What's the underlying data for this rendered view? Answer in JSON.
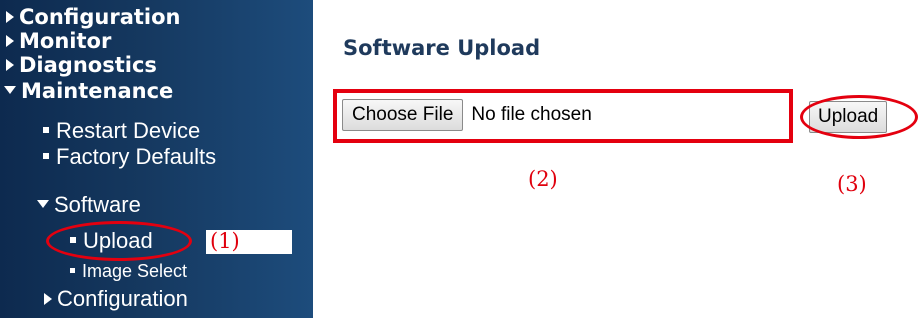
{
  "sidebar": {
    "items": [
      {
        "label": "Configuration",
        "icon": "triangle-right-icon"
      },
      {
        "label": "Monitor",
        "icon": "triangle-right-icon"
      },
      {
        "label": "Diagnostics",
        "icon": "triangle-right-icon"
      },
      {
        "label": "Maintenance",
        "icon": "triangle-down-icon"
      }
    ],
    "maintenance": {
      "restart": "Restart Device",
      "factory": "Factory Defaults",
      "software": "Software",
      "upload": "Upload",
      "image_select": "Image Select",
      "configuration": "Configuration"
    }
  },
  "main": {
    "title": "Software Upload",
    "choose_label": "Choose File",
    "file_status": "No file chosen",
    "upload_label": "Upload"
  },
  "annotations": {
    "step1": "(1)",
    "step2": "(2)",
    "step3": "(3)",
    "color": "#e4000f"
  },
  "colors": {
    "sidebar_bg": "#15385f",
    "title": "#1f3a5c"
  }
}
